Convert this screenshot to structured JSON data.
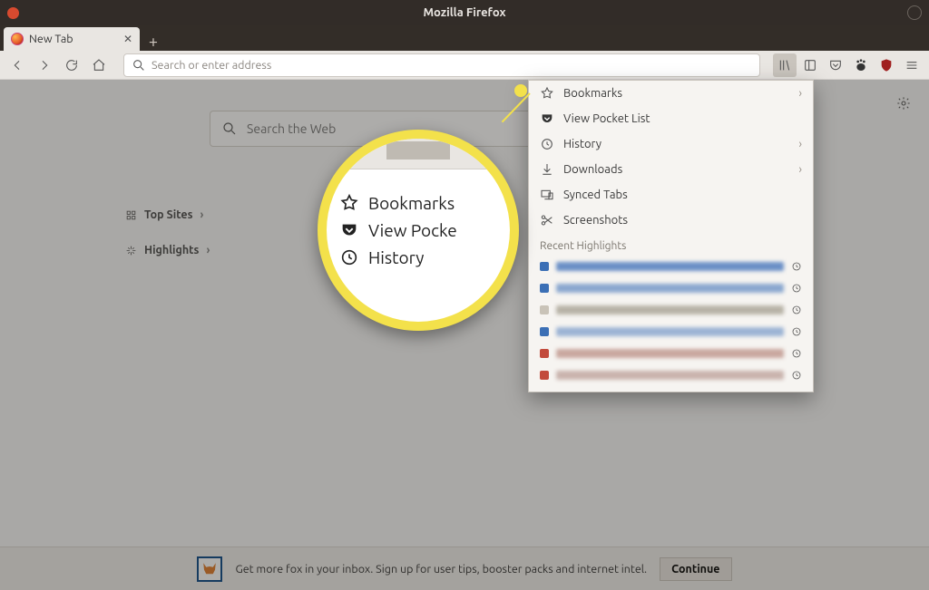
{
  "window": {
    "title": "Mozilla Firefox"
  },
  "tab": {
    "label": "New Tab"
  },
  "urlbar": {
    "placeholder": "Search or enter address"
  },
  "ntp": {
    "search_placeholder": "Search the Web",
    "top_sites": "Top Sites",
    "highlights": "Highlights"
  },
  "library_menu": {
    "bookmarks": "Bookmarks",
    "pocket": "View Pocket List",
    "history": "History",
    "downloads": "Downloads",
    "synced": "Synced Tabs",
    "screenshots": "Screenshots",
    "recent_heading": "Recent Highlights"
  },
  "magnifier": {
    "bookmarks": "Bookmarks",
    "pocket": "View Pocke",
    "history": "History"
  },
  "snippet": {
    "text": "Get more fox in your inbox. Sign up for user tips, booster packs and internet intel.",
    "button": "Continue"
  }
}
